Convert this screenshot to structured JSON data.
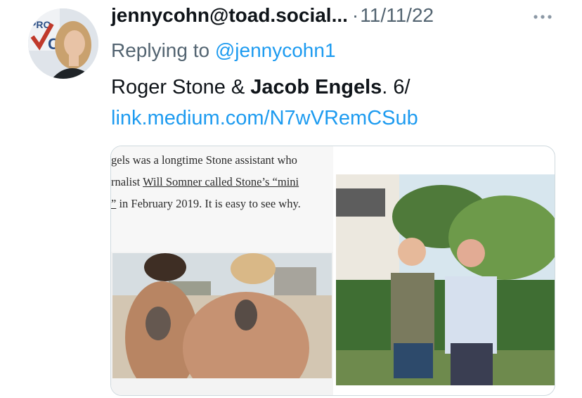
{
  "tweet": {
    "handle": "jennycohn@toad.social...",
    "separator": "·",
    "date": "11/11/22",
    "replying_prefix": "Replying to",
    "replying_mention": "@jennycohn1",
    "text_part1": "Roger Stone & ",
    "text_bold": "Jacob Engels",
    "text_part2": ". 6/",
    "link": "link.medium.com/N7wVRemCSub"
  },
  "avatar": {
    "logo_text_1": "PRO",
    "logo_text_2": "C"
  },
  "media": {
    "article_lines": {
      "line1": "gels was a longtime Stone assistant who",
      "line2_prefix": "rnalist ",
      "line2_link": "Will Somner called Stone’s “mini",
      "line3_link": "”",
      "line3_rest": " in February 2019. It is easy to see why."
    }
  },
  "icons": {
    "more": "more-horizontal-icon"
  },
  "colors": {
    "accent": "#1d9bf0",
    "secondary_text": "#536471",
    "border": "#cfd9de"
  }
}
